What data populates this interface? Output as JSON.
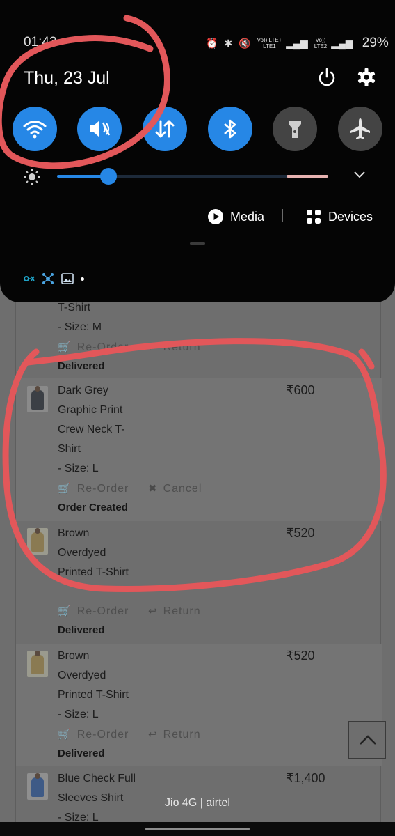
{
  "status_bar": {
    "time": "01:43",
    "volte1": "Vo))",
    "lte1": "LTE+",
    "lte1_sub": "LTE1",
    "volte2": "Vo))",
    "lte2_sub": "LTE2",
    "battery": "29%"
  },
  "shade": {
    "date": "Thu, 23 Jul",
    "tiles": [
      {
        "name": "wifi",
        "state": "on"
      },
      {
        "name": "sound-mute",
        "state": "on"
      },
      {
        "name": "mobile-data",
        "state": "on"
      },
      {
        "name": "bluetooth",
        "state": "on"
      },
      {
        "name": "flashlight",
        "state": "off"
      },
      {
        "name": "airplane",
        "state": "off"
      }
    ],
    "brightness_level": 0.19,
    "media_label": "Media",
    "devices_label": "Devices"
  },
  "orders": [
    {
      "name_lines": [
        "T-Shirt"
      ],
      "size": " - Size: M",
      "price": "",
      "action1": "Re-Order",
      "action2": "Return",
      "status": "Delivered"
    },
    {
      "name_lines": [
        "Dark Grey",
        "Graphic Print",
        "Crew Neck T-",
        "Shirt"
      ],
      "size": " - Size: L",
      "price": "₹600",
      "action1": "Re-Order",
      "action2": "Cancel",
      "status": "Order Created"
    },
    {
      "name_lines": [
        "Brown",
        "Overdyed",
        "Printed T-Shirt"
      ],
      "size": "",
      "price": "₹520",
      "action1": "Re-Order",
      "action2": "Return",
      "status": "Delivered"
    },
    {
      "name_lines": [
        "Brown",
        "Overdyed",
        "Printed T-Shirt"
      ],
      "size": " - Size: L",
      "price": "₹520",
      "action1": "Re-Order",
      "action2": "Return",
      "status": "Delivered"
    },
    {
      "name_lines": [
        "Blue Check Full",
        "Sleeves Shirt"
      ],
      "size": " - Size: L",
      "price": "₹1,400",
      "action1": "",
      "action2": "",
      "status": ""
    }
  ],
  "carrier_text": "Jio 4G | airtel",
  "colors": {
    "tile_on": "#2687e6",
    "tile_off": "#444444",
    "annotation": "#e2575a"
  }
}
